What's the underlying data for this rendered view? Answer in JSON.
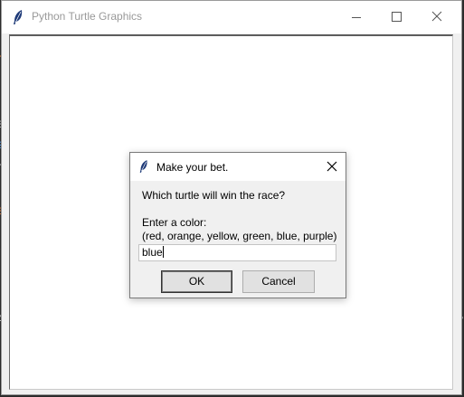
{
  "window": {
    "title": "Python Turtle Graphics",
    "minimize_icon": "minimize-icon",
    "maximize_icon": "maximize-icon",
    "close_icon": "close-icon"
  },
  "dialog": {
    "title": "Make your bet.",
    "question": "Which turtle will win the race?",
    "prompt_line1": "Enter a color:",
    "prompt_line2": "(red, orange, yellow, green, blue, purple)",
    "input_value": "blue",
    "ok_label": "OK",
    "cancel_label": "Cancel"
  },
  "colors": {
    "accent_orange": "#e07b39",
    "accent_blue": "#4a8fd8"
  }
}
